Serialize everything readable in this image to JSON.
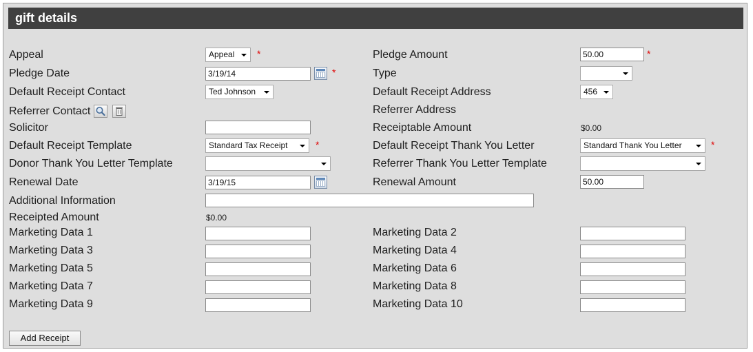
{
  "section_title": "gift details",
  "left": {
    "appeal_label": "Appeal",
    "appeal_value": "Appeal",
    "pledge_date_label": "Pledge Date",
    "pledge_date_value": "3/19/14",
    "default_receipt_contact_label": "Default Receipt Contact",
    "default_receipt_contact_value": "Ted Johnson",
    "referrer_contact_label": "Referrer Contact",
    "solicitor_label": "Solicitor",
    "solicitor_value": "",
    "default_receipt_template_label": "Default Receipt Template",
    "default_receipt_template_value": "Standard Tax Receipt",
    "donor_thank_you_label": "Donor Thank You Letter Template",
    "donor_thank_you_value": "",
    "renewal_date_label": "Renewal Date",
    "renewal_date_value": "3/19/15",
    "additional_info_label": "Additional Information",
    "additional_info_value": "",
    "receipted_amount_label": "Receipted Amount",
    "receipted_amount_value": "$0.00"
  },
  "right": {
    "pledge_amount_label": "Pledge Amount",
    "pledge_amount_value": "50.00",
    "type_label": "Type",
    "type_value": "",
    "default_receipt_address_label": "Default Receipt Address",
    "default_receipt_address_value": "456",
    "referrer_address_label": "Referrer Address",
    "receiptable_amount_label": "Receiptable Amount",
    "receiptable_amount_value": "$0.00",
    "default_receipt_thank_you_label": "Default Receipt Thank You Letter",
    "default_receipt_thank_you_value": "Standard Thank You Letter",
    "referrer_thank_you_label": "Referrer Thank You Letter Template",
    "referrer_thank_you_value": "",
    "renewal_amount_label": "Renewal Amount",
    "renewal_amount_value": "50.00"
  },
  "marketing": [
    {
      "label": "Marketing Data 1",
      "value": ""
    },
    {
      "label": "Marketing Data 2",
      "value": ""
    },
    {
      "label": "Marketing Data 3",
      "value": ""
    },
    {
      "label": "Marketing Data 4",
      "value": ""
    },
    {
      "label": "Marketing Data 5",
      "value": ""
    },
    {
      "label": "Marketing Data 6",
      "value": ""
    },
    {
      "label": "Marketing Data 7",
      "value": ""
    },
    {
      "label": "Marketing Data 8",
      "value": ""
    },
    {
      "label": "Marketing Data 9",
      "value": ""
    },
    {
      "label": "Marketing Data 10",
      "value": ""
    }
  ],
  "required_mark": "*",
  "add_receipt_label": "Add Receipt",
  "icons": {
    "calendar": "calendar-icon",
    "search": "search-icon",
    "delete": "trash-icon"
  }
}
